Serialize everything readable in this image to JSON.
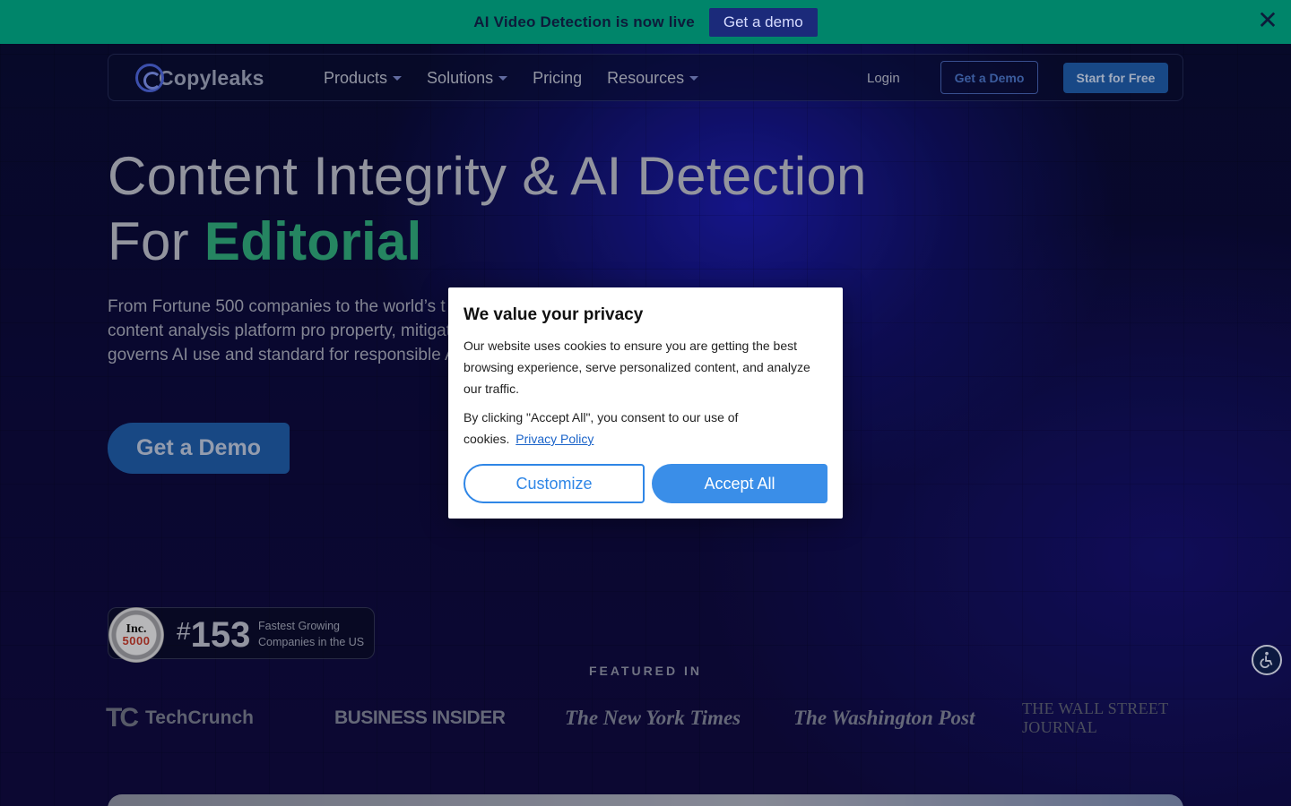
{
  "announcement": {
    "text": "AI Video Detection is now live",
    "button": "Get a demo",
    "close_glyph": "✕"
  },
  "nav": {
    "logo": "Copyleaks",
    "menu": [
      {
        "label": "Products",
        "has_dropdown": true
      },
      {
        "label": "Solutions",
        "has_dropdown": true
      },
      {
        "label": "Pricing",
        "has_dropdown": false
      },
      {
        "label": "Resources",
        "has_dropdown": true
      }
    ],
    "login": "Login",
    "get_demo": "Get a Demo",
    "start_free": "Start for Free"
  },
  "hero": {
    "title_line1": "Content Integrity & AI Detection",
    "title_line2_prefix": "For ",
    "title_accent": "Editorial",
    "description": "From Fortune 500 companies to the world’s t our AI-powered content analysis platform pro property, mitigates fraud, governs AI use and standard for responsible AI adoption.",
    "cta": "Get a Demo"
  },
  "inc_badge": {
    "seal_top": "Inc.",
    "seal_num": "5000",
    "hash": "#",
    "rank": "153",
    "label": "Fastest Growing Companies in the US"
  },
  "featured": {
    "heading": "FEATURED IN",
    "outlets": [
      "TechCrunch",
      "BUSINESS INSIDER",
      "The New York Times",
      "The Washington Post",
      "THE WALL STREET JOURNAL"
    ],
    "tc_mark": "TC"
  },
  "cookie_modal": {
    "title": "We value your privacy",
    "body": "Our website uses cookies to ensure you are getting the best browsing experience, serve personalized content, and analyze our traffic.",
    "consent": "By clicking \"Accept All\", you consent to our use of cookies.",
    "policy_link": "Privacy Policy",
    "customize": "Customize",
    "accept": "Accept All"
  },
  "colors": {
    "announcement_bg": "#00856a",
    "accent_green": "#2fa77a",
    "primary_blue": "#1f5aa6",
    "modal_button": "#3a8ee8"
  }
}
